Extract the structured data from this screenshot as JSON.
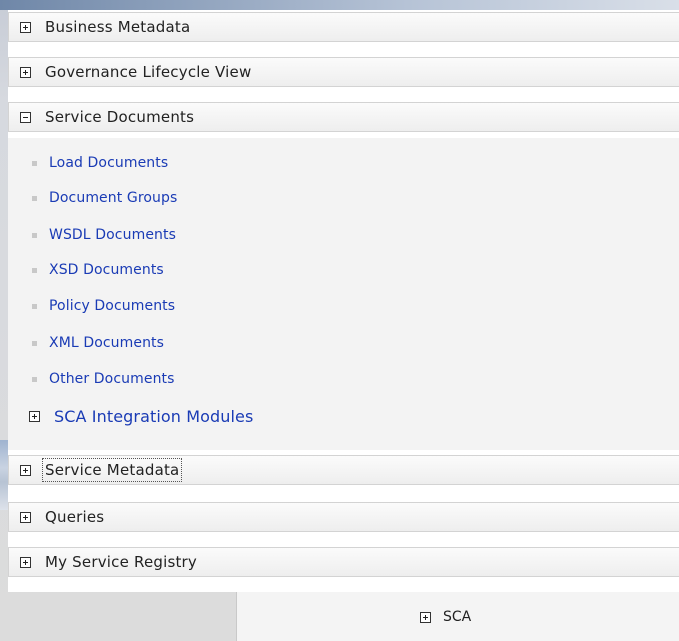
{
  "sections": [
    {
      "label": "Business Metadata",
      "expanded": false
    },
    {
      "label": "Governance Lifecycle View",
      "expanded": false
    },
    {
      "label": "Service Documents",
      "expanded": true
    },
    {
      "label": "Service Metadata",
      "expanded": false
    },
    {
      "label": "Queries",
      "expanded": false
    },
    {
      "label": "My Service Registry",
      "expanded": false
    }
  ],
  "service_documents": {
    "items": [
      "Load Documents",
      "Document Groups",
      "WSDL Documents",
      "XSD Documents",
      "Policy Documents",
      "XML Documents",
      "Other Documents"
    ],
    "nested_group": "SCA Integration Modules"
  },
  "background": {
    "sca_label": "SCA"
  },
  "colors": {
    "link": "#1a3bb5",
    "header_text": "#222222",
    "sub_background": "#f3f3f3"
  }
}
